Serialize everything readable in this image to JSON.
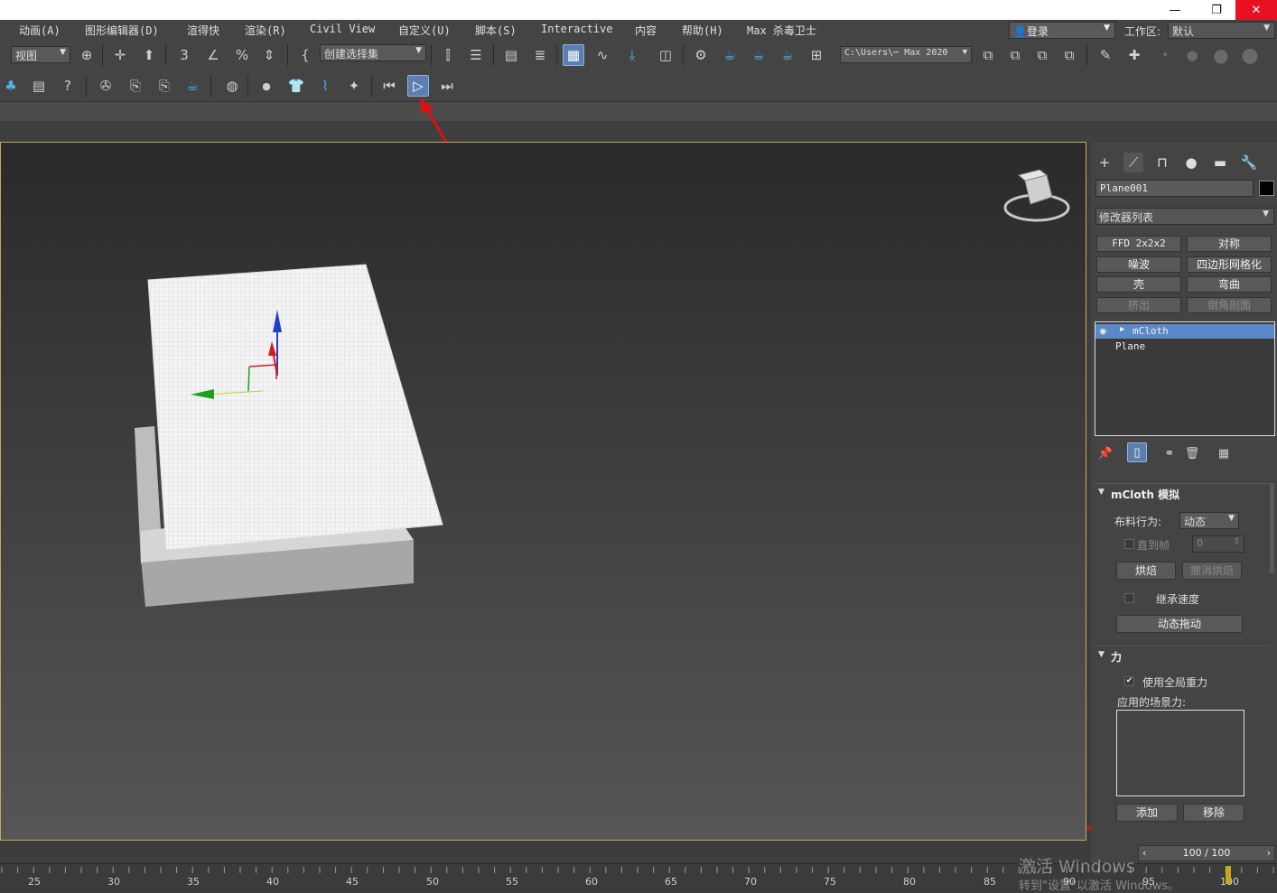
{
  "window": {
    "minimize": "—",
    "restore": "❐",
    "close": "✕"
  },
  "menu": [
    "动画(A)",
    "图形编辑器(D)",
    "渲得快",
    "渲染(R)",
    "Civil View",
    "自定义(U)",
    "脚本(S)",
    "Interactive",
    "内容",
    "帮助(H)",
    "Max 杀毒卫士"
  ],
  "login": "登录",
  "workspace": {
    "label": "工作区:",
    "value": "默认"
  },
  "toolbar1": {
    "view_dropdown": "视图",
    "selection_set": "创建选择集",
    "path": "C:\\Users\\⋯ Max 2020"
  },
  "object": {
    "name": "Plane001",
    "color": "#000000"
  },
  "modifier_list": "修改器列表",
  "modifier_buttons": [
    {
      "label": "FFD 2x2x2",
      "enabled": true
    },
    {
      "label": "对称",
      "enabled": true
    },
    {
      "label": "噪波",
      "enabled": true
    },
    {
      "label": "四边形网格化",
      "enabled": true
    },
    {
      "label": "壳",
      "enabled": true
    },
    {
      "label": "弯曲",
      "enabled": true
    },
    {
      "label": "挤出",
      "enabled": false
    },
    {
      "label": "倒角剖面",
      "enabled": false
    }
  ],
  "stack": [
    {
      "label": "mCloth",
      "selected": true
    },
    {
      "label": "Plane",
      "selected": false
    }
  ],
  "mcloth": {
    "title": "mCloth 模拟",
    "behavior_label": "布料行为:",
    "behavior_value": "动态",
    "until_frame_label": "直到帧",
    "until_frame_value": "0",
    "bake": "烘焙",
    "unbake": "撤消烘焙",
    "inherit_velocity": "继承速度",
    "dynamic_drag": "动态拖动"
  },
  "forces": {
    "title": "力",
    "use_gravity": "使用全局重力",
    "applied_forces_label": "应用的场景力:",
    "add": "添加",
    "remove": "移除"
  },
  "time_slider": "100 / 100",
  "timeline_ticks": [
    "25",
    "30",
    "35",
    "40",
    "45",
    "50",
    "55",
    "60",
    "65",
    "70",
    "75",
    "80",
    "85",
    "90",
    "95",
    "100"
  ],
  "watermark": {
    "line1": "激活 Windows",
    "line2": "转到\"设置\"以激活 Windows。"
  }
}
